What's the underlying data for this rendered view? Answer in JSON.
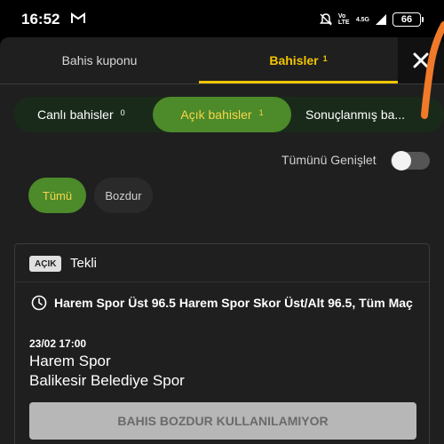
{
  "status_bar": {
    "time": "16:52",
    "network_top": "4.5G",
    "volte_label": "Vo LTE",
    "battery": "66"
  },
  "tabs": {
    "coupon": "Bahis kuponu",
    "bets": "Bahisler",
    "bets_count": "1"
  },
  "segments": [
    {
      "label": "Canlı bahisler",
      "count": "0"
    },
    {
      "label": "Açık bahisler",
      "count": "1"
    },
    {
      "label": "Sonuçlanmış ba..."
    }
  ],
  "expand": {
    "label": "Tümünü Genişlet",
    "enabled": false
  },
  "chips": {
    "all": "Tümü",
    "cashout": "Bozdur"
  },
  "bet_card": {
    "badge": "AÇIK",
    "type": "Tekli",
    "market": "Harem Spor Üst 96.5 Harem Spor Skor Üst/Alt 96.5, Tüm Maç",
    "datetime": "23/02 17:00",
    "home_team": "Harem Spor",
    "away_team": "Balikesir Belediye Spor",
    "cashout_button": "BAHIS BOZDUR KULLANILAMIYOR"
  },
  "colors": {
    "accent_yellow": "#f2c400",
    "active_green": "#4c8a2a",
    "swipe_orange": "#f07a2a"
  }
}
